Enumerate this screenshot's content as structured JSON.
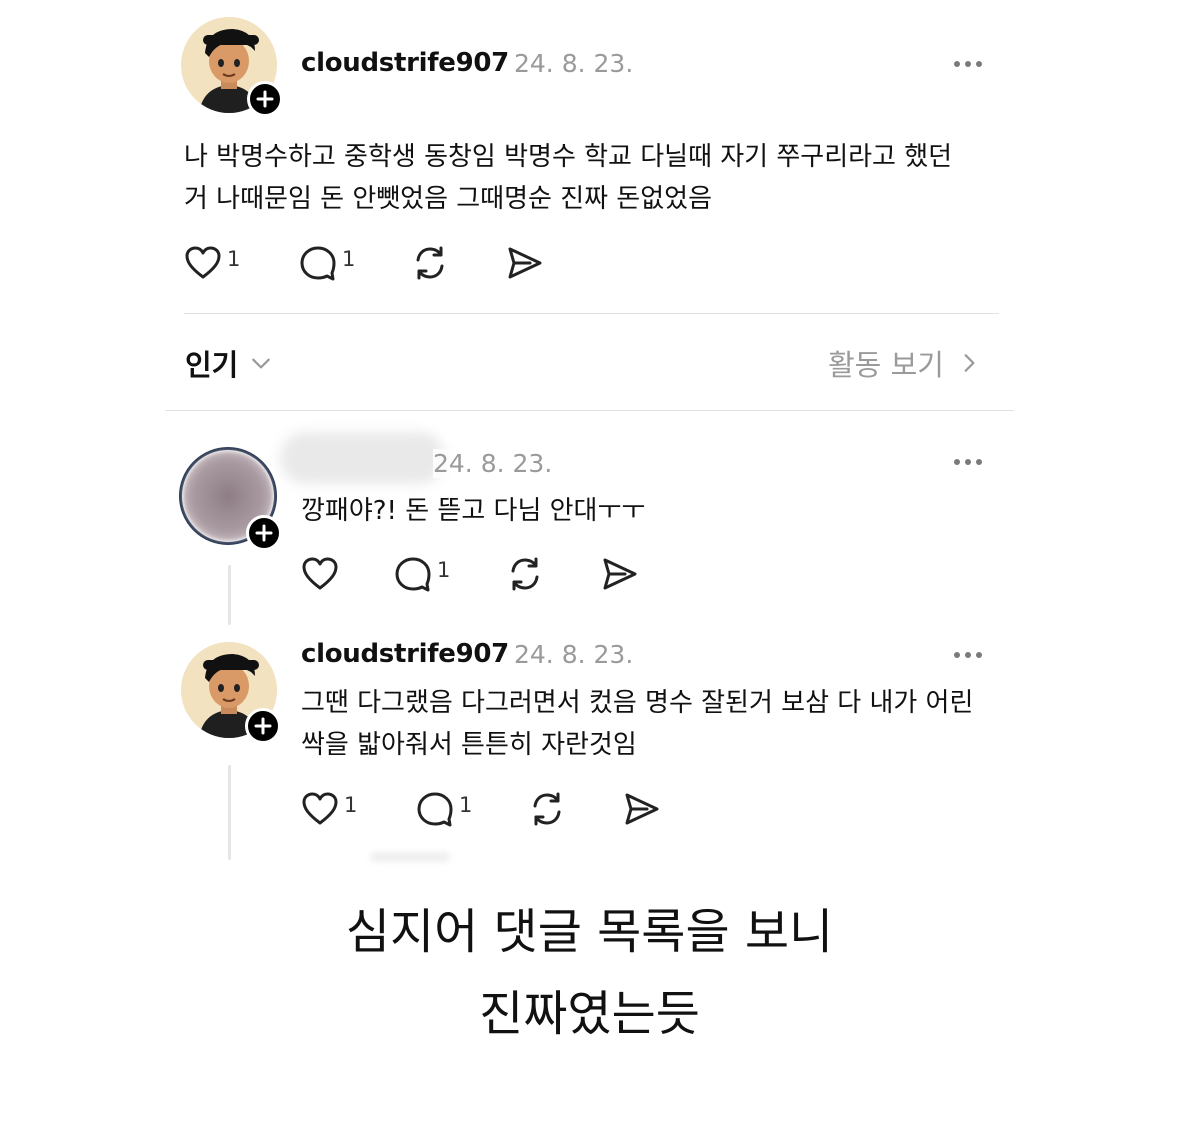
{
  "post": {
    "username": "cloudstrife907",
    "date": "24. 8. 23.",
    "text": "나 박명수하고 중학생 동창임 박명수 학교 다닐때 자기 쭈구리라고 했던\n거 나때문임 돈 안뺏었음 그때명순 진짜 돈없었음",
    "like_count": "1",
    "reply_count": "1"
  },
  "sort_bar": {
    "sort_label": "인기",
    "activity_label": "활동 보기"
  },
  "comments": [
    {
      "username": "",
      "date": "24. 8. 23.",
      "text": "깡패야?! 돈 뜯고 다님 안대ㅜㅜ",
      "like_count": "",
      "reply_count": "1"
    },
    {
      "username": "cloudstrife907",
      "date": "24. 8. 23.",
      "text": "그땐 다그랬음 다그러면서 컸음 명수 잘된거 보삼 다 내가 어린\n싹을 밟아줘서 튼튼히 자란것임",
      "like_count": "1",
      "reply_count": "1"
    }
  ],
  "caption": {
    "line1": "심지어 댓글 목록을 보니",
    "line2": "진짜였는듯"
  },
  "icons": {
    "like": "heart-icon",
    "reply": "speech-bubble-icon",
    "repost": "repost-icon",
    "share": "send-icon",
    "more": "more-dots-icon",
    "follow": "plus-icon",
    "sort": "chevron-down-icon",
    "activity": "chevron-right-icon"
  }
}
